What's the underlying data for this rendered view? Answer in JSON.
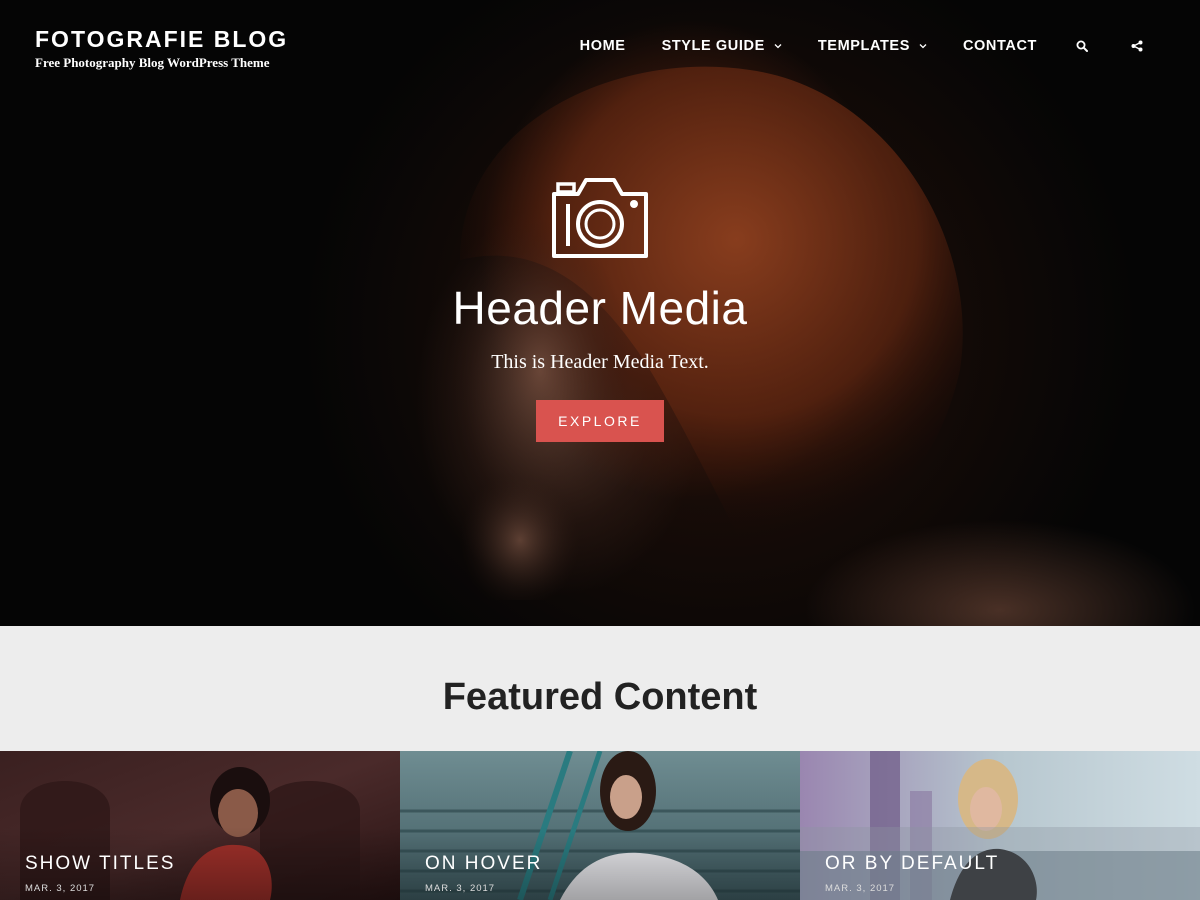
{
  "site": {
    "title": "FOTOGRAFIE BLOG",
    "description": "Free Photography Blog WordPress Theme"
  },
  "nav": {
    "items": [
      {
        "label": "HOME",
        "has_dropdown": false
      },
      {
        "label": "STYLE GUIDE",
        "has_dropdown": true
      },
      {
        "label": "TEMPLATES",
        "has_dropdown": true
      },
      {
        "label": "CONTACT",
        "has_dropdown": false
      }
    ],
    "icons": [
      "search-icon",
      "share-icon"
    ]
  },
  "hero": {
    "icon": "camera-icon",
    "title": "Header Media",
    "text": "This is Header Media Text.",
    "button_label": "EXPLORE"
  },
  "featured": {
    "heading": "Featured Content",
    "cards": [
      {
        "title": "SHOW TITLES",
        "date": "MAR. 3, 2017"
      },
      {
        "title": "ON HOVER",
        "date": "MAR. 3, 2017"
      },
      {
        "title": "OR BY DEFAULT",
        "date": "MAR. 3, 2017"
      }
    ]
  },
  "colors": {
    "accent": "#d9534f",
    "hero_background": "#050505",
    "featured_background": "#ededed",
    "heading_text": "#222222"
  }
}
